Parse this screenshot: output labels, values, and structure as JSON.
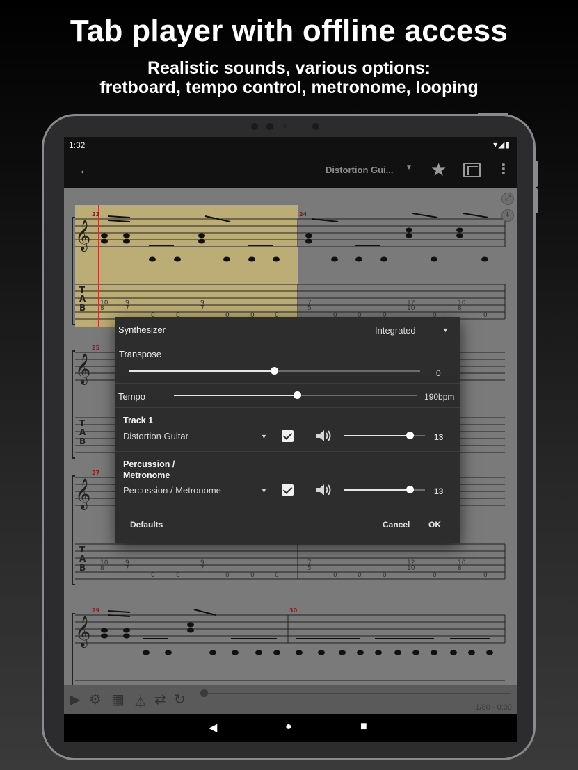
{
  "promo": {
    "headline": "Tab player with offline access",
    "subline_1": "Realistic sounds, various options:",
    "subline_2": "fretboard, tempo control, metronome, looping"
  },
  "status_bar": {
    "time": "1:32",
    "icons": [
      "wifi-icon",
      "signal-icon",
      "battery-icon"
    ]
  },
  "app_bar": {
    "back_icon": "back-arrow-icon",
    "track_selector": "Distortion Gui...",
    "favorite_icon": "star-icon",
    "fullscreen_icon": "fullscreen-icon",
    "more_icon": "more-vert-icon"
  },
  "score": {
    "measure_numbers": [
      "23",
      "24",
      "25",
      "27",
      "29",
      "30"
    ],
    "highlight_color": "#c8b675",
    "cursor_color": "#c0392b"
  },
  "dialog": {
    "synth_label": "Synthesizer",
    "synth_value": "Integrated",
    "transpose_label": "Transpose",
    "transpose_value": "0",
    "transpose_level": 0.5,
    "tempo_label": "Tempo",
    "tempo_value": "190bpm",
    "tempo_level": 0.5,
    "tracks": [
      {
        "name": "Track 1",
        "instrument": "Distortion Guitar",
        "enabled": true,
        "volume": "13",
        "volume_level": 0.81
      },
      {
        "name_1": "Percussion /",
        "name_2": "Metronome",
        "instrument": "Percussion / Metronome",
        "enabled": true,
        "volume": "13",
        "volume_level": 0.81
      }
    ],
    "defaults_label": "Defaults",
    "cancel_label": "Cancel",
    "ok_label": "OK"
  },
  "player": {
    "position": "1/80 - 0:00",
    "tools": [
      "play-icon",
      "settings-icon",
      "fretboard-icon",
      "metronome-icon",
      "loop-icon",
      "speed-icon"
    ]
  },
  "nav_bar": {
    "icons": [
      "nav-back-icon",
      "nav-home-icon",
      "nav-recents-icon"
    ]
  }
}
